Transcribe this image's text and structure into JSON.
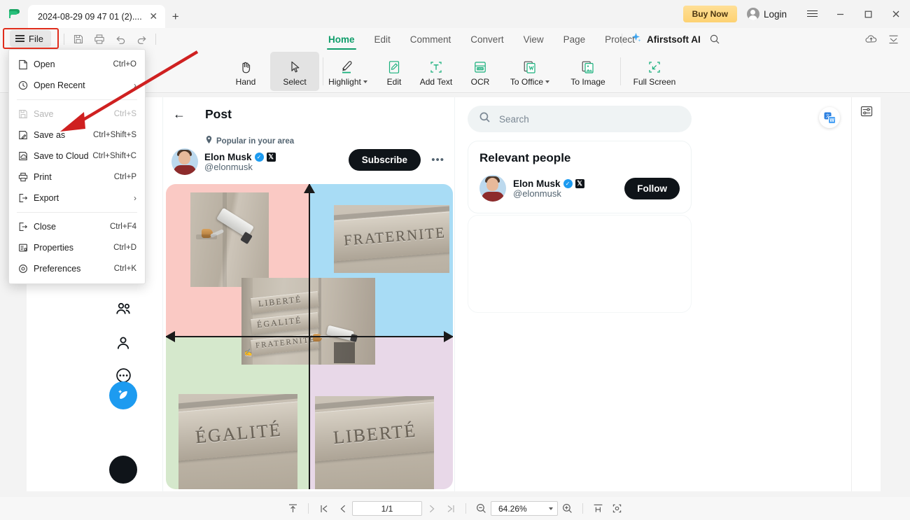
{
  "titlebar": {
    "logo_icon": "afirstsoft-logo-icon",
    "tab_label": "2024-08-29 09 47 01 (2)....",
    "tab_close_icon": "close-icon",
    "new_tab_icon": "plus-icon",
    "buy_now_label": "Buy Now",
    "login_label": "Login",
    "avatar_icon": "user-avatar-icon",
    "menu_icon": "hamburger-menu-icon",
    "minimize_icon": "minimize-icon",
    "maximize_icon": "maximize-icon",
    "close_icon": "close-window-icon"
  },
  "ribbon": {
    "file_label": "File",
    "file_menu_icon": "hamburger-icon",
    "quick_access": [
      {
        "name": "save-icon",
        "label": "Save"
      },
      {
        "name": "print-icon",
        "label": "Print"
      },
      {
        "name": "undo-icon",
        "label": "Undo"
      },
      {
        "name": "redo-icon",
        "label": "Redo"
      }
    ],
    "tabs": [
      {
        "label": "Home",
        "active": true
      },
      {
        "label": "Edit",
        "active": false
      },
      {
        "label": "Comment",
        "active": false
      },
      {
        "label": "Convert",
        "active": false
      },
      {
        "label": "View",
        "active": false
      },
      {
        "label": "Page",
        "active": false
      },
      {
        "label": "Protect",
        "active": false
      }
    ],
    "ai_label": "Afirstsoft AI",
    "ai_sparkle_icon": "sparkle-icon",
    "ai_search_icon": "search-icon",
    "cloud_icon": "cloud-upload-icon",
    "collapse_icon": "collapse-ribbon-icon",
    "buttons": [
      {
        "label": "Hand",
        "icon": "hand-icon",
        "selected": false,
        "dropdown": false
      },
      {
        "label": "Select",
        "icon": "cursor-select-icon",
        "selected": true,
        "dropdown": false
      },
      {
        "label": "Highlight",
        "icon": "highlight-pen-icon",
        "selected": false,
        "dropdown": true
      },
      {
        "label": "Edit",
        "icon": "edit-pencil-icon",
        "selected": false,
        "dropdown": false
      },
      {
        "label": "Add Text",
        "icon": "add-text-icon",
        "selected": false,
        "dropdown": false
      },
      {
        "label": "OCR",
        "icon": "ocr-icon",
        "selected": false,
        "dropdown": false
      },
      {
        "label": "To Office",
        "icon": "to-office-icon",
        "selected": false,
        "dropdown": true
      },
      {
        "label": "To Image",
        "icon": "to-image-icon",
        "selected": false,
        "dropdown": false
      },
      {
        "label": "Full Screen",
        "icon": "full-screen-icon",
        "selected": false,
        "dropdown": false
      }
    ]
  },
  "file_menu": {
    "items": [
      {
        "label": "Open",
        "shortcut": "Ctrl+O",
        "icon": "open-file-icon",
        "disabled": false,
        "submenu": false
      },
      {
        "label": "Open Recent",
        "shortcut": "",
        "icon": "clock-recent-icon",
        "disabled": false,
        "submenu": true
      },
      {
        "divider_after": true,
        "label": "",
        "shortcut": "",
        "icon": "",
        "disabled": false,
        "submenu": false
      },
      {
        "label": "Save",
        "shortcut": "Ctrl+S",
        "icon": "save-disk-icon",
        "disabled": true,
        "submenu": false
      },
      {
        "label": "Save as",
        "shortcut": "Ctrl+Shift+S",
        "icon": "save-as-icon",
        "disabled": false,
        "submenu": false
      },
      {
        "label": "Save to Cloud",
        "shortcut": "Ctrl+Shift+C",
        "icon": "save-cloud-icon",
        "disabled": false,
        "submenu": false
      },
      {
        "label": "Print",
        "shortcut": "Ctrl+P",
        "icon": "print-icon",
        "disabled": false,
        "submenu": false
      },
      {
        "label": "Export",
        "shortcut": "",
        "icon": "export-icon",
        "disabled": false,
        "submenu": true
      },
      {
        "divider_after2": true,
        "label": "",
        "shortcut": "",
        "icon": "",
        "disabled": false,
        "submenu": false
      },
      {
        "label": "Close",
        "shortcut": "Ctrl+F4",
        "icon": "close-doc-icon",
        "disabled": false,
        "submenu": false
      },
      {
        "label": "Properties",
        "shortcut": "Ctrl+D",
        "icon": "properties-icon",
        "disabled": false,
        "submenu": false
      },
      {
        "label": "Preferences",
        "shortcut": "Ctrl+K",
        "icon": "preferences-gear-icon",
        "disabled": false,
        "submenu": false
      }
    ],
    "highlight_color": "#e02d1c",
    "annotation_arrow_color": "#cf2020"
  },
  "document": {
    "twitter_nav_icons": [
      "compose-square-icon",
      "communities-icon",
      "profile-person-icon",
      "more-circle-icon"
    ],
    "compose_icon": "feather-compose-icon",
    "account_icon": "account-avatar-icon",
    "back_icon": "back-arrow-icon",
    "page_title": "Post",
    "popular_label": "Popular in your area",
    "location_icon": "location-pin-icon",
    "author_name": "Elon Musk",
    "author_handle": "@elonmusk",
    "verified_icon": "verified-badge-icon",
    "x_badge_icon": "x-premium-badge-icon",
    "subscribe_label": "Subscribe",
    "more_icon": "more-options-icon",
    "search_placeholder": "Search",
    "search_icon": "search-icon",
    "relevant_title": "Relevant people",
    "follow_label": "Follow",
    "translate_icon": "translate-word-icon",
    "rail_icon": "properties-panel-icon",
    "collage": {
      "quadrant_colors": [
        "#fac9c4",
        "#a8dcf5",
        "#d5e8cc",
        "#e8d8e8"
      ],
      "axis_color": "#1a1a1a",
      "engraved_words": [
        "FRATERNITE",
        "LIBERTE",
        "EGALITE",
        "FRATERNITE",
        "EGALITE",
        "LIBERTE"
      ]
    }
  },
  "statusbar": {
    "fit_top_icon": "scroll-to-top-icon",
    "first_page_icon": "first-page-icon",
    "prev_page_icon": "prev-page-icon",
    "page_value": "1/1",
    "next_page_icon": "next-page-icon",
    "last_page_icon": "last-page-icon",
    "zoom_out_icon": "zoom-out-icon",
    "zoom_value": "64.26%",
    "zoom_dropdown_icon": "chevron-down-icon",
    "zoom_in_icon": "zoom-in-icon",
    "fit_width_icon": "fit-width-icon",
    "fit_page_icon": "fit-page-icon"
  }
}
